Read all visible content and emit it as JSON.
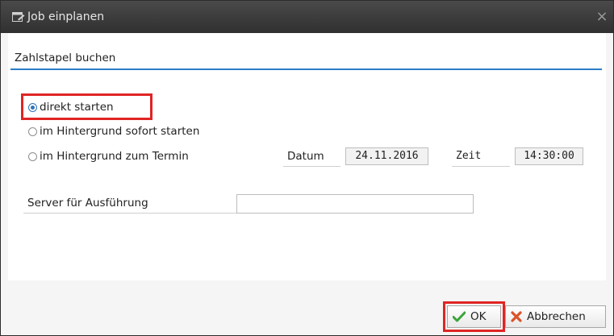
{
  "window": {
    "title": "Job einplanen",
    "close_glyph": "×"
  },
  "group": {
    "title": "Zahlstapel buchen"
  },
  "options": [
    {
      "label": "direkt starten",
      "selected": true
    },
    {
      "label": "im Hintergrund sofort starten",
      "selected": false
    },
    {
      "label": "im Hintergrund zum Termin",
      "selected": false
    }
  ],
  "schedule": {
    "date_label": "Datum",
    "date_value": "24.11.2016",
    "time_label": "Zeit",
    "time_value": "14:30:00"
  },
  "server": {
    "label": "Server für Ausführung",
    "value": ""
  },
  "buttons": {
    "ok_label": "OK",
    "cancel_label": "Abbrechen"
  },
  "colors": {
    "accent": "#2c7dc5",
    "highlight": "#e02424",
    "ok_check": "#3aa53a",
    "cancel_x": "#d9532a"
  },
  "icons": {
    "title": "dialog-icon",
    "close": "close-icon",
    "ok": "checkmark-icon",
    "cancel": "cancel-x-icon"
  }
}
